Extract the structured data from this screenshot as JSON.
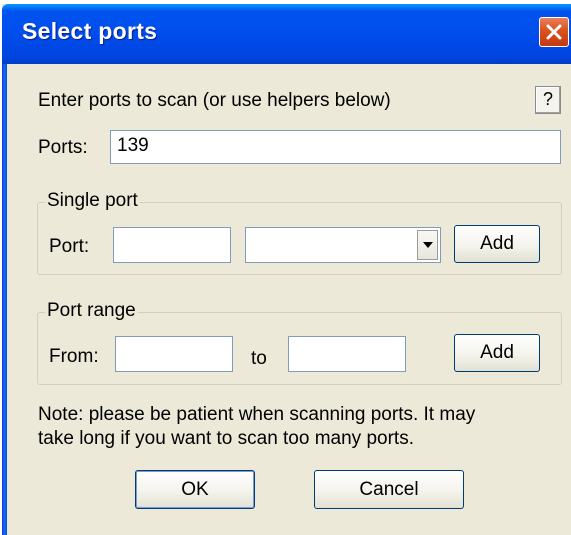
{
  "window": {
    "title": "Select ports"
  },
  "icons": {
    "close": "close-icon",
    "dropdown": "chevron-down-icon"
  },
  "colors": {
    "titlebar": "#0050ee",
    "close_button": "#d9531e",
    "dialog_bg": "#ece9d8"
  },
  "instructions": "Enter ports to scan (or use helpers below)",
  "help_label": "?",
  "ports": {
    "label": "Ports:",
    "value": "139"
  },
  "single_port": {
    "legend": "Single port",
    "port_label": "Port:",
    "port_value": "",
    "protocol_selected": "",
    "add_label": "Add"
  },
  "port_range": {
    "legend": "Port range",
    "from_label": "From:",
    "from_value": "",
    "to_label": "to",
    "to_value": "",
    "add_label": "Add"
  },
  "note": {
    "line1": "Note: please be patient when scanning ports. It may",
    "line2": "take long if you want to scan too many ports."
  },
  "buttons": {
    "ok": "OK",
    "cancel": "Cancel"
  }
}
